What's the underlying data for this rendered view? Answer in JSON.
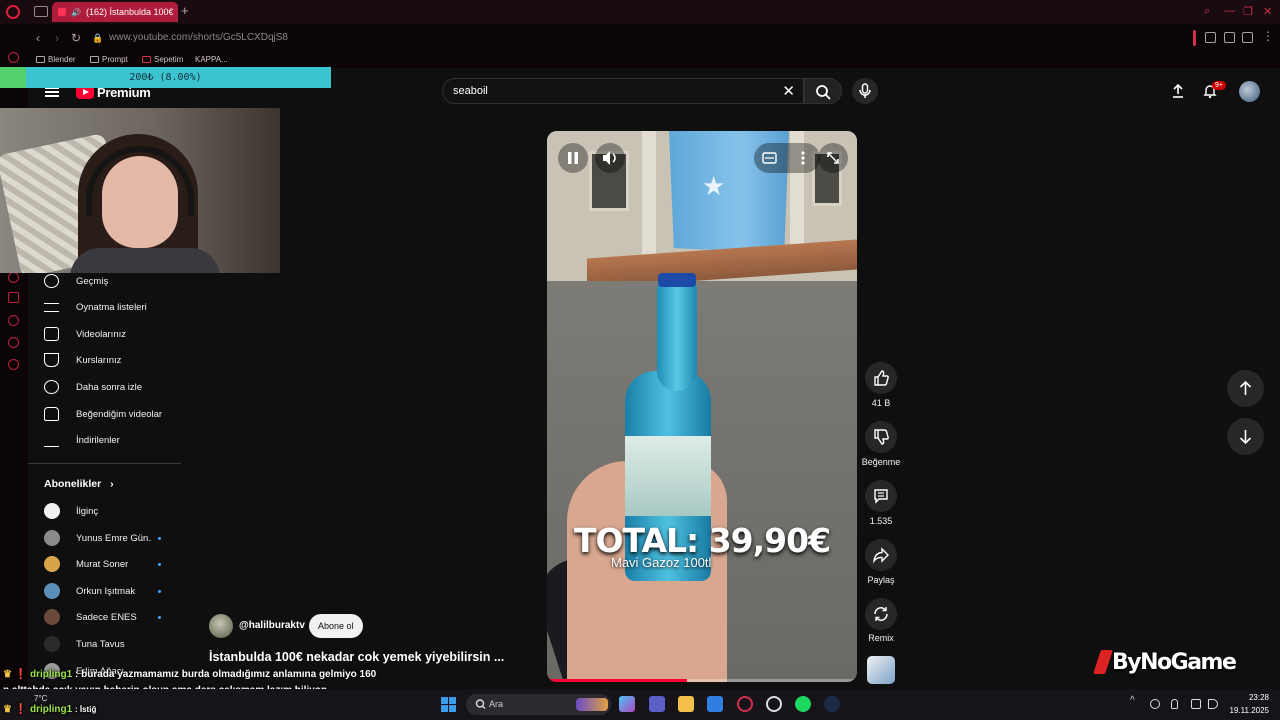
{
  "browser": {
    "tab_title": "(162) İstanbulda 100€",
    "url": "www.youtube.com/shorts/Gc5LCXDqjS8",
    "bookmarks": [
      "Blender",
      "Prompt",
      "Sepetim",
      "KAPPA..."
    ]
  },
  "donation": {
    "text": "200₺ (8.00%)",
    "progress_percent": 8
  },
  "youtube": {
    "logo_text": "Premium",
    "search_query": "seaboil",
    "notification_count": "9+",
    "guide": [
      {
        "label": "Geçmiş",
        "icon": "history-icon"
      },
      {
        "label": "Oynatma listeleri",
        "icon": "playlists-icon"
      },
      {
        "label": "Videolarınız",
        "icon": "your-videos-icon"
      },
      {
        "label": "Kurslarınız",
        "icon": "courses-icon"
      },
      {
        "label": "Daha sonra izle",
        "icon": "watch-later-icon"
      },
      {
        "label": "Beğendiğim videolar",
        "icon": "liked-videos-icon"
      },
      {
        "label": "İndirilenler",
        "icon": "downloads-icon"
      }
    ],
    "subscriptions_title": "Abonelikler",
    "subscriptions": [
      {
        "label": "İlginç",
        "color": "#ffffff",
        "dot": false
      },
      {
        "label": "Yunus Emre Gün...",
        "color": "#8a8a8a",
        "dot": true
      },
      {
        "label": "Murat Soner",
        "color": "#d9a34a",
        "dot": true
      },
      {
        "label": "Orkun Işıtmak",
        "color": "#5b8fb8",
        "dot": true
      },
      {
        "label": "Sadece ENES",
        "color": "#6a4a3a",
        "dot": true
      },
      {
        "label": "Tuna Tavus",
        "color": "#2a2a2a",
        "dot": false
      },
      {
        "label": "Erlim Ağacı",
        "color": "#9a9a9a",
        "dot": false
      }
    ]
  },
  "short": {
    "overlay_total": "TOTAL: 39,90€",
    "overlay_sub": "Mavi Gazoz 100tl",
    "progress_fraction": 0.45,
    "channel": "@halilburaktv",
    "subscribe_label": "Abone ol",
    "title": "İstanbulda 100€ nekadar cok yemek yiyebilirsin ...",
    "actions": {
      "likes": "41 B",
      "dislike_label": "Beğenme",
      "comments": "1.535",
      "share_label": "Paylaş",
      "remix_label": "Remix"
    }
  },
  "watermark": "ByNoGame",
  "chat": [
    {
      "user": "dripling1",
      "message": ": burada yazmamamız burda olmadığımız anlamına gelmiyo 160"
    },
    {
      "user": "",
      "message": "p alttabda açık yayın haberin olsun ama ders çalışmam lazım biliyon"
    },
    {
      "user": "dripling1",
      "message": ": İstiğ"
    }
  ],
  "taskbar": {
    "weather": "7°C",
    "search_placeholder": "Ara",
    "time": "23:28",
    "date": "19.11.2025"
  },
  "colors": {
    "accent_red": "#ff0033",
    "opera_red": "#d4304d",
    "donation_bg": "#3cc3d2"
  }
}
